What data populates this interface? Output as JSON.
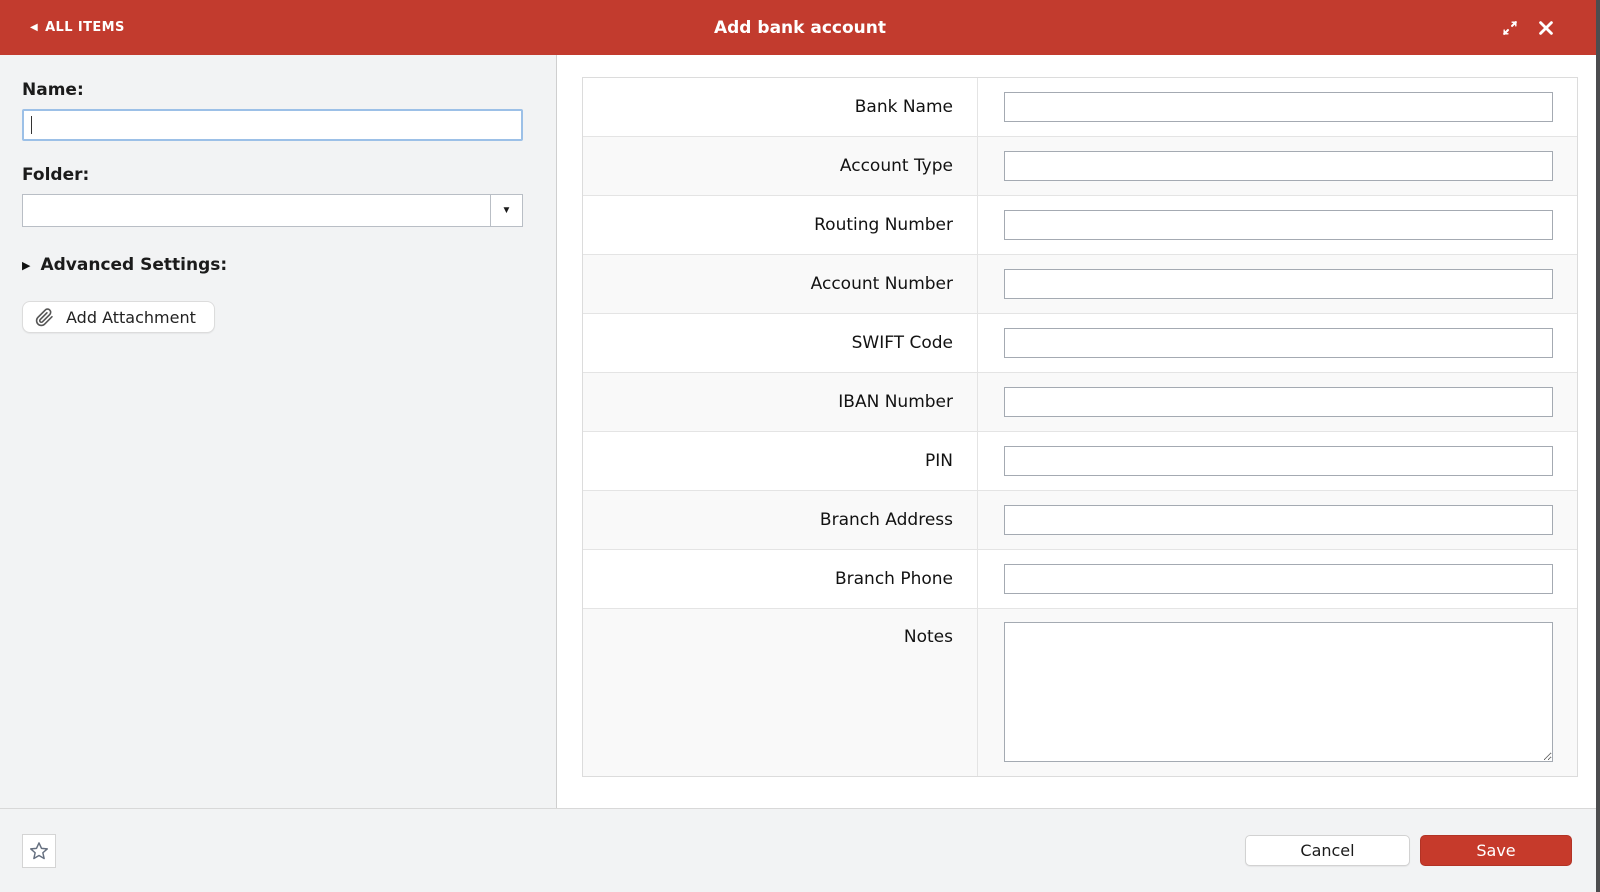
{
  "header": {
    "back_label": "ALL ITEMS",
    "title": "Add bank account"
  },
  "left_panel": {
    "name_label": "Name:",
    "name_value": "",
    "folder_label": "Folder:",
    "folder_value": "",
    "advanced_settings_label": "Advanced Settings:",
    "add_attachment_label": "Add Attachment"
  },
  "form": {
    "fields": [
      {
        "label": "Bank Name",
        "value": "",
        "type": "text"
      },
      {
        "label": "Account Type",
        "value": "",
        "type": "text"
      },
      {
        "label": "Routing Number",
        "value": "",
        "type": "text"
      },
      {
        "label": "Account Number",
        "value": "",
        "type": "text"
      },
      {
        "label": "SWIFT Code",
        "value": "",
        "type": "text"
      },
      {
        "label": "IBAN Number",
        "value": "",
        "type": "text"
      },
      {
        "label": "PIN",
        "value": "",
        "type": "text"
      },
      {
        "label": "Branch Address",
        "value": "",
        "type": "text"
      },
      {
        "label": "Branch Phone",
        "value": "",
        "type": "text"
      },
      {
        "label": "Notes",
        "value": "",
        "type": "textarea"
      }
    ]
  },
  "footer": {
    "cancel_label": "Cancel",
    "save_label": "Save"
  },
  "icons": {
    "back": "back-triangle-icon",
    "expand": "expand-icon",
    "close": "close-icon",
    "dropdown": "chevron-down-icon",
    "collapsed": "triangle-right-icon",
    "attachment": "paperclip-icon",
    "favorite": "star-icon"
  },
  "colors": {
    "header_bg": "#c23b2e",
    "save_bg": "#c63a2b",
    "panel_bg": "#f2f3f4",
    "focus_border": "#9cc0e7",
    "input_border": "#a4aab2"
  }
}
